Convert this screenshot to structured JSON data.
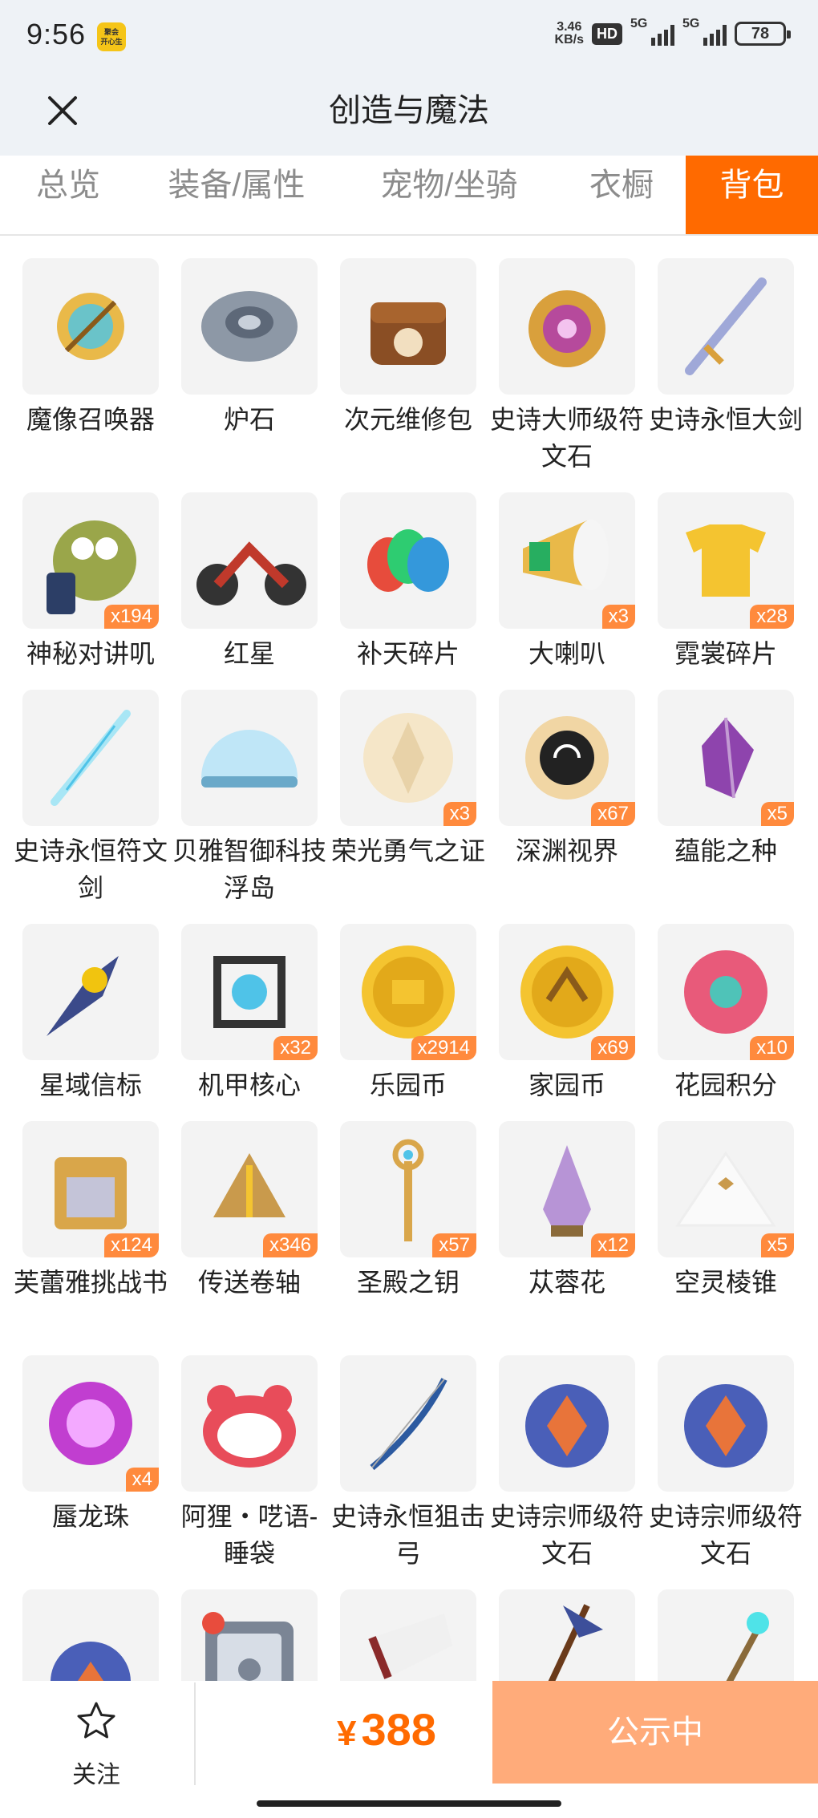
{
  "status_bar": {
    "time": "9:56",
    "app_icon_text": "聚会\n开心生",
    "speed_top": "3.46",
    "speed_bottom": "KB/s",
    "hd": "HD",
    "network_1": "5G",
    "network_2": "5G",
    "battery": "78"
  },
  "header": {
    "title": "创造与魔法",
    "close_icon": "close-icon"
  },
  "tabs": [
    {
      "label": "总览",
      "active": false
    },
    {
      "label": "装备/属性",
      "active": false
    },
    {
      "label": "宠物/坐骑",
      "active": false
    },
    {
      "label": "衣橱",
      "active": false
    },
    {
      "label": "背包",
      "active": true
    }
  ],
  "items": [
    {
      "name": "魔像召唤器",
      "qty": ""
    },
    {
      "name": "炉石",
      "qty": ""
    },
    {
      "name": "次元维修包",
      "qty": ""
    },
    {
      "name": "史诗大师级符文石",
      "qty": ""
    },
    {
      "name": "史诗永恒大剑",
      "qty": ""
    },
    {
      "name": "神秘对讲叽",
      "qty": "x194"
    },
    {
      "name": "红星",
      "qty": ""
    },
    {
      "name": "补天碎片",
      "qty": ""
    },
    {
      "name": "大喇叭",
      "qty": "x3"
    },
    {
      "name": "霓裳碎片",
      "qty": "x28"
    },
    {
      "name": "史诗永恒符文剑",
      "qty": ""
    },
    {
      "name": "贝雅智御科技浮岛",
      "qty": ""
    },
    {
      "name": "荣光勇气之证",
      "qty": "x3"
    },
    {
      "name": "深渊视界",
      "qty": "x67"
    },
    {
      "name": "蕴能之种",
      "qty": "x5"
    },
    {
      "name": "星域信标",
      "qty": ""
    },
    {
      "name": "机甲核心",
      "qty": "x32"
    },
    {
      "name": "乐园币",
      "qty": "x2914"
    },
    {
      "name": "家园币",
      "qty": "x69"
    },
    {
      "name": "花园积分",
      "qty": "x10"
    },
    {
      "name": "芙蕾雅挑战书",
      "qty": "x124"
    },
    {
      "name": "传送卷轴",
      "qty": "x346"
    },
    {
      "name": "圣殿之钥",
      "qty": "x57"
    },
    {
      "name": "苁蓉花",
      "qty": "x12"
    },
    {
      "name": "空灵棱锥",
      "qty": "x5"
    },
    {
      "name": "蜃龙珠",
      "qty": "x4"
    },
    {
      "name": "阿狸・呓语-睡袋",
      "qty": ""
    },
    {
      "name": "史诗永恒狙击弓",
      "qty": ""
    },
    {
      "name": "史诗宗师级符文石",
      "qty": ""
    },
    {
      "name": "史诗宗师级符文石",
      "qty": ""
    },
    {
      "name": "",
      "qty": ""
    },
    {
      "name": "",
      "qty": ""
    },
    {
      "name": "",
      "qty": ""
    },
    {
      "name": "",
      "qty": ""
    },
    {
      "name": "",
      "qty": ""
    }
  ],
  "bottom_bar": {
    "follow_label": "关注",
    "currency": "¥",
    "price": "388",
    "status_label": "公示中"
  },
  "colors": {
    "accent": "#ff6a00",
    "qty_badge": "#ff8a3d",
    "status_button": "#ffab7a"
  }
}
